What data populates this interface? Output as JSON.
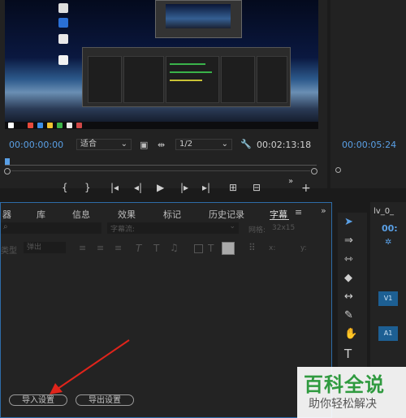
{
  "program_monitor": {
    "timecode_current": "00:00:00:00",
    "fit": "适合",
    "resolution": "1/2",
    "timecode_duration": "00:02:13:18"
  },
  "source_monitor": {
    "timecode": "00:00:05:24"
  },
  "panel": {
    "tabs": [
      "器",
      "库",
      "信息",
      "效果",
      "标记",
      "历史记录",
      "字幕"
    ],
    "caption_stream_placeholder": "字幕流:",
    "grid_label": "网格:",
    "grid_value": "32x15",
    "type_label": "类型",
    "type_value": "弹出",
    "x_label": "x:",
    "y_label": "y:",
    "import_button": "导入设置",
    "export_button": "导出设置"
  },
  "timeline": {
    "sequence_name": "lv_0_",
    "timecode": "00:",
    "tracks": [
      "V1",
      "A1"
    ]
  },
  "watermark": {
    "title": "百科全说",
    "subtitle": "助你轻松解决"
  },
  "colors": {
    "accent_blue": "#5aa0e6",
    "panel_border": "#2e6ca8",
    "track_blue": "#1d5f93",
    "watermark_green": "#2f9a3f",
    "arrow_red": "#e0241b"
  }
}
